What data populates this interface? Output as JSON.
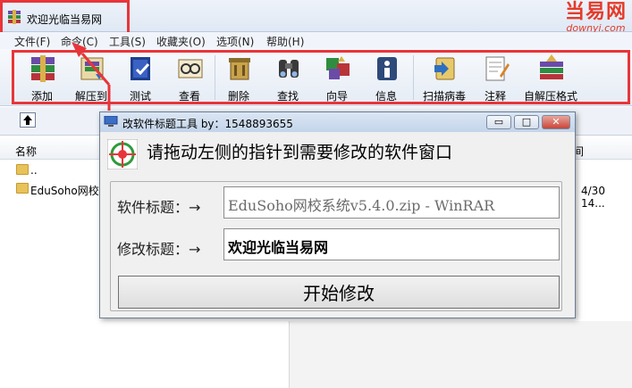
{
  "window": {
    "title": "欢迎光临当易网"
  },
  "watermark": {
    "line1": "当易网",
    "line2": "downyi.com"
  },
  "menu": [
    "文件(F)",
    "命令(C)",
    "工具(S)",
    "收藏夹(O)",
    "选项(N)",
    "帮助(H)"
  ],
  "toolbar": {
    "buttons": [
      {
        "label": "添加",
        "icon": "add-archive-icon"
      },
      {
        "label": "解压到",
        "icon": "extract-to-icon"
      },
      {
        "label": "测试",
        "icon": "test-icon"
      },
      {
        "label": "查看",
        "icon": "view-icon"
      },
      {
        "label": "删除",
        "icon": "delete-icon"
      },
      {
        "label": "查找",
        "icon": "find-icon"
      },
      {
        "label": "向导",
        "icon": "wizard-icon"
      },
      {
        "label": "信息",
        "icon": "info-icon"
      },
      {
        "label": "扫描病毒",
        "icon": "virus-scan-icon"
      },
      {
        "label": "注释",
        "icon": "comment-icon"
      },
      {
        "label": "自解压格式",
        "icon": "sfx-icon"
      }
    ]
  },
  "filelist": {
    "col_name": "名称",
    "col_time": "间",
    "rows": [
      {
        "name": ".."
      },
      {
        "name": "EduSoho网校",
        "time": "4/30 14..."
      }
    ]
  },
  "dialog": {
    "title": "改软件标题工具 by：1548893655",
    "controls": {
      "minimize": "▭",
      "maximize": "□",
      "close": "✕"
    },
    "instruction": "请拖动左侧的指针到需要修改的软件窗口",
    "orig_label": "软件标题：→",
    "orig_value": "EduSoho网校系统v5.4.0.zip - WinRAR",
    "new_label": "修改标题：→",
    "new_value": "欢迎光临当易网",
    "start_button": "开始修改"
  },
  "colors": {
    "highlight": "#e8353a",
    "accent": "#c3d4ea"
  }
}
